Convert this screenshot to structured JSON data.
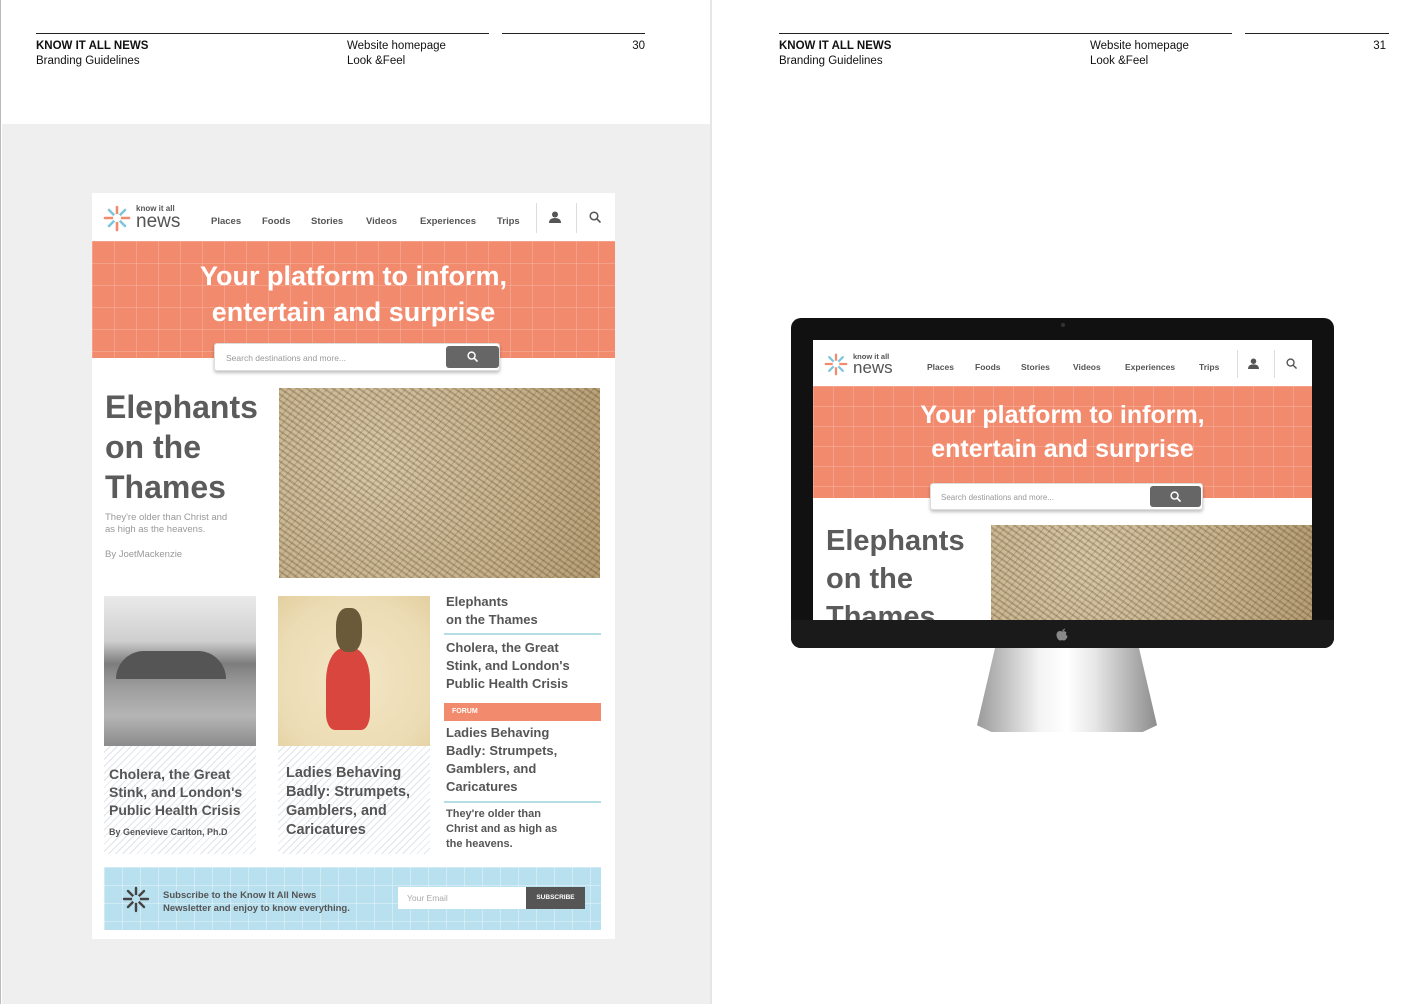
{
  "left_page": {
    "brand": "KNOW IT ALL NEWS",
    "subtitle": "Branding Guidelines",
    "section": "Website homepage",
    "subsection": "Look &Feel",
    "page_number": "30"
  },
  "right_page": {
    "brand": "KNOW IT ALL NEWS",
    "subtitle": "Branding Guidelines",
    "section": "Website homepage",
    "subsection": "Look &Feel",
    "page_number": "31"
  },
  "site": {
    "logo_small": "know it all",
    "logo_big": "news",
    "nav": [
      "Places",
      "Foods",
      "Stories",
      "Videos",
      "Experiences",
      "Trips"
    ],
    "hero_line1": "Your platform to inform,",
    "hero_line2": "entertain and surprise",
    "search_placeholder": "Search destinations and more...",
    "feature": {
      "title_line1": "Elephants",
      "title_line2": "on the",
      "title_line3": "Thames",
      "dek_line1": "They're older than Christ and",
      "dek_line2": "as high as the heavens.",
      "byline": "By JoetMackenzie"
    },
    "card1": {
      "line1": "Cholera, the Great",
      "line2": "Stink, and London's",
      "line3": "Public Health Crisis",
      "byline": "By Genevieve Carlton, Ph.D"
    },
    "card2": {
      "line1": "Ladies Behaving",
      "line2": "Badly: Strumpets,",
      "line3": "Gamblers, and",
      "line4": "Caricatures"
    },
    "sidebar": {
      "item1_line1": "Elephants",
      "item1_line2": "on the Thames",
      "item2_line1": "Cholera, the Great",
      "item2_line2": "Stink, and London's",
      "item2_line3": "Public Health Crisis",
      "forum_label": "FORUM",
      "item3_line1": "Ladies Behaving",
      "item3_line2": "Badly: Strumpets,",
      "item3_line3": "Gamblers, and",
      "item3_line4": "Caricatures",
      "item4_line1": "They're older than",
      "item4_line2": "Christ and as high as",
      "item4_line3": "the heavens."
    },
    "newsletter": {
      "line1": "Subscribe to the Know It All News",
      "line2": "Newsletter and enjoy to know everything.",
      "email_placeholder": "Your Email",
      "button": "SUBSCRIBE"
    }
  },
  "monitor_site": {
    "logo_small": "know it all",
    "logo_big": "news",
    "nav": [
      "Places",
      "Foods",
      "Stories",
      "Videos",
      "Experiences",
      "Trips"
    ],
    "hero_line1": "Your platform to inform,",
    "hero_line2": "entertain and surprise",
    "search_placeholder": "Search destinations and more...",
    "title_line1": "Elephants",
    "title_line2": "on the",
    "title_line3": "Thames"
  },
  "colors": {
    "coral": "#f28b6e",
    "sky": "#b9e0ef",
    "grey_text": "#5b5b5b",
    "spread_grey": "#efefef"
  }
}
